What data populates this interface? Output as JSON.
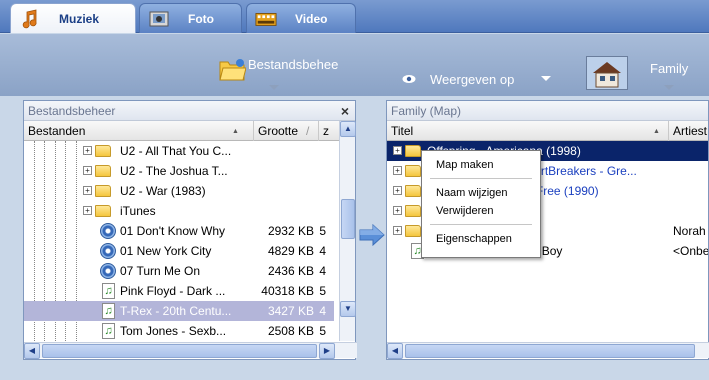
{
  "tabs": [
    {
      "label": "Muziek",
      "icon": "music-note-icon",
      "active": true
    },
    {
      "label": "Foto",
      "icon": "camera-icon",
      "active": false
    },
    {
      "label": "Video",
      "icon": "film-icon",
      "active": false
    }
  ],
  "toolbar": {
    "bestandsbeheer_label": "Bestandsbehee",
    "weergeven_label": "Weergeven op",
    "family_label": "Family"
  },
  "left_panel": {
    "title": "Bestandsbeheer",
    "close": "×",
    "columns": [
      "Bestanden",
      "Grootte",
      "z"
    ],
    "column_sep": "/",
    "rows": [
      {
        "name": "U2 - All That You C...",
        "size": "",
        "extra": "",
        "type": "folder"
      },
      {
        "name": "U2 - The Joshua T...",
        "size": "",
        "extra": "",
        "type": "folder"
      },
      {
        "name": "U2 - War (1983)",
        "size": "",
        "extra": "",
        "type": "folder"
      },
      {
        "name": "iTunes",
        "size": "",
        "extra": "",
        "type": "folder"
      },
      {
        "name": "01 Don't Know Why",
        "size": "2932 KB",
        "extra": "5",
        "type": "cd"
      },
      {
        "name": "01 New York City",
        "size": "4829 KB",
        "extra": "4",
        "type": "cd"
      },
      {
        "name": "07 Turn Me On",
        "size": "2436 KB",
        "extra": "4",
        "type": "cd"
      },
      {
        "name": "Pink Floyd - Dark ...",
        "size": "40318 KB",
        "extra": "5",
        "type": "note"
      },
      {
        "name": "T-Rex - 20th Centu...",
        "size": "3427 KB",
        "extra": "4",
        "type": "note",
        "selected": true
      },
      {
        "name": "Tom Jones - Sexb...",
        "size": "2508 KB",
        "extra": "5",
        "type": "note"
      }
    ]
  },
  "right_panel": {
    "title": "Family (Map)",
    "columns": [
      "Titel",
      "Artiest"
    ],
    "rows": [
      {
        "title": "Offspring - Americana (1998)",
        "artist": "",
        "selected": true
      },
      {
        "title": "Tom Petty & The HeartBreakers - Gre...",
        "artist": ""
      },
      {
        "title": "Traveling Wilburys - Free (1990)",
        "artist": ""
      },
      {
        "title": "",
        "artist": ""
      },
      {
        "title": "",
        "artist": "Norah"
      },
      {
        "title": "T-Rex - 20th Century Boy",
        "artist": "<Onbe"
      }
    ],
    "visible_fragments": {
      "row0": "Offspring - Americana (1998)",
      "row1": "eartBreakers - Gre...",
      "row2": "ree (1990)",
      "row5": "T-Rex - 20th Century Boy"
    }
  },
  "context_menu": {
    "items": [
      "Map maken",
      "Naam wijzigen",
      "Verwijderen",
      "Eigenschappen"
    ]
  },
  "colors": {
    "accent": "#4f78bd",
    "selection_dark": "#0a246a",
    "selection_light": "#b3b5d9",
    "link_blue": "#1a3fbf"
  }
}
